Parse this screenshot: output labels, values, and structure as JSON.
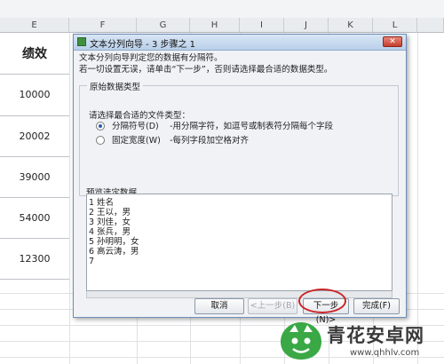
{
  "columns": [
    "E",
    "F",
    "G",
    "H",
    "I",
    "J",
    "K",
    "L"
  ],
  "sheet": {
    "header": "绩效",
    "values": [
      "10000",
      "20002",
      "39000",
      "54000",
      "12300"
    ]
  },
  "dialog": {
    "title": "文本分列向导 - 3 步骤之 1",
    "close": "✕",
    "intro_line1": "文本分列向导判定您的数据有分隔符。",
    "intro_line2": "若一切设置无误，请单击“下一步”，否则请选择最合适的数据类型。",
    "group_title": "原始数据类型",
    "choose_label": "请选择最合适的文件类型：",
    "options": [
      {
        "label": "分隔符号(D)",
        "desc": "-用分隔字符，如逗号或制表符分隔每个字段",
        "selected": true
      },
      {
        "label": "固定宽度(W)",
        "desc": "-每列字段加空格对齐",
        "selected": false
      }
    ],
    "preview_label": "预览选定数据",
    "preview_lines": [
      {
        "n": "1",
        "text": "姓名"
      },
      {
        "n": "2",
        "text": "王以，男"
      },
      {
        "n": "3",
        "text": "刘佳，女"
      },
      {
        "n": "4",
        "text": "张兵，男"
      },
      {
        "n": "5",
        "text": "孙明明，女"
      },
      {
        "n": "6",
        "text": "高云涛，男"
      },
      {
        "n": "7",
        "text": ""
      }
    ],
    "buttons": {
      "cancel": "取消",
      "back": "<上一步(B)",
      "next": "下一步(N)>",
      "finish": "完成(F)"
    }
  },
  "watermark": {
    "title": "青花安卓网",
    "url": "www.qhhlv.com"
  },
  "colors": {
    "accent": "#2a5caa",
    "highlight_circle": "#c9252a",
    "logo_green": "#3aa845"
  }
}
